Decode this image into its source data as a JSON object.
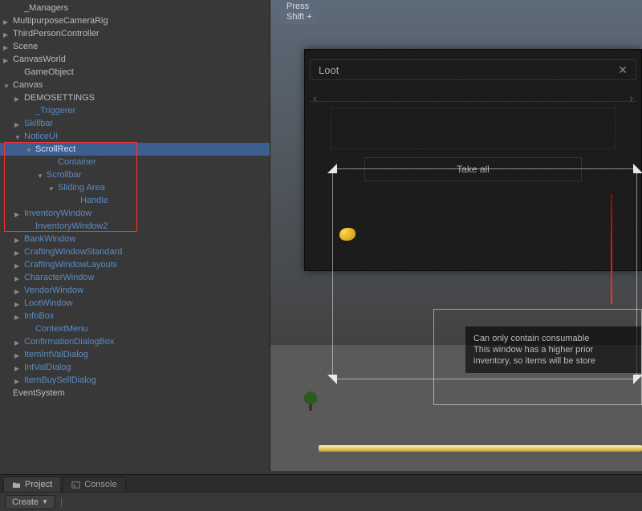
{
  "hierarchy": [
    {
      "label": "_Managers",
      "indent": 1,
      "arrow": "none",
      "style": "plain"
    },
    {
      "label": "MultipurposeCameraRig",
      "indent": 0,
      "arrow": "right",
      "style": "plain"
    },
    {
      "label": "ThirdPersonController",
      "indent": 0,
      "arrow": "right",
      "style": "plain"
    },
    {
      "label": "Scene",
      "indent": 0,
      "arrow": "right",
      "style": "plain"
    },
    {
      "label": "CanvasWorld",
      "indent": 0,
      "arrow": "right",
      "style": "plain"
    },
    {
      "label": "GameObject",
      "indent": 1,
      "arrow": "none",
      "style": "plain"
    },
    {
      "label": "Canvas",
      "indent": 0,
      "arrow": "down",
      "style": "plain"
    },
    {
      "label": "DEMOSETTINGS",
      "indent": 1,
      "arrow": "right",
      "style": "plain"
    },
    {
      "label": "_Triggerer",
      "indent": 2,
      "arrow": "none",
      "style": "link"
    },
    {
      "label": "Skillbar",
      "indent": 1,
      "arrow": "right",
      "style": "link"
    },
    {
      "label": "NoticeUI",
      "indent": 1,
      "arrow": "down",
      "style": "link"
    },
    {
      "label": "ScrollRect",
      "indent": 2,
      "arrow": "down",
      "style": "link",
      "selected": true
    },
    {
      "label": "Container",
      "indent": 4,
      "arrow": "none",
      "style": "link"
    },
    {
      "label": "Scrollbar",
      "indent": 3,
      "arrow": "down",
      "style": "link"
    },
    {
      "label": "Sliding Area",
      "indent": 4,
      "arrow": "down",
      "style": "link"
    },
    {
      "label": "Handle",
      "indent": 6,
      "arrow": "none",
      "style": "link"
    },
    {
      "label": "InventoryWindow",
      "indent": 1,
      "arrow": "right",
      "style": "link"
    },
    {
      "label": "InventoryWindow2",
      "indent": 2,
      "arrow": "none",
      "style": "link"
    },
    {
      "label": "BankWindow",
      "indent": 1,
      "arrow": "right",
      "style": "link"
    },
    {
      "label": "CraftingWindowStandard",
      "indent": 1,
      "arrow": "right",
      "style": "link"
    },
    {
      "label": "CraftingWindowLayouts",
      "indent": 1,
      "arrow": "right",
      "style": "link"
    },
    {
      "label": "CharacterWindow",
      "indent": 1,
      "arrow": "right",
      "style": "link"
    },
    {
      "label": "VendorWindow",
      "indent": 1,
      "arrow": "right",
      "style": "link"
    },
    {
      "label": "LootWindow",
      "indent": 1,
      "arrow": "right",
      "style": "link"
    },
    {
      "label": "InfoBox",
      "indent": 1,
      "arrow": "right",
      "style": "link"
    },
    {
      "label": "ContextMenu",
      "indent": 2,
      "arrow": "none",
      "style": "link"
    },
    {
      "label": "ConfirmationDialogBox",
      "indent": 1,
      "arrow": "right",
      "style": "link"
    },
    {
      "label": "ItemIntValDialog",
      "indent": 1,
      "arrow": "right",
      "style": "link"
    },
    {
      "label": "IntValDialog",
      "indent": 1,
      "arrow": "right",
      "style": "link"
    },
    {
      "label": "ItemBuySellDialog",
      "indent": 1,
      "arrow": "right",
      "style": "link"
    },
    {
      "label": "EventSystem",
      "indent": 0,
      "arrow": "none",
      "style": "plain"
    }
  ],
  "scene": {
    "info_pill_l1": "Press",
    "info_pill_l2": "Shift +",
    "loot_title": "Loot",
    "take_all": "Take all",
    "tooltip_l1": "Can only contain consumable",
    "tooltip_l2": "This window has a higher prior",
    "tooltip_l3": "inventory, so items will be store"
  },
  "tabs": {
    "project": "Project",
    "console": "Console"
  },
  "toolbar": {
    "create": "Create"
  }
}
